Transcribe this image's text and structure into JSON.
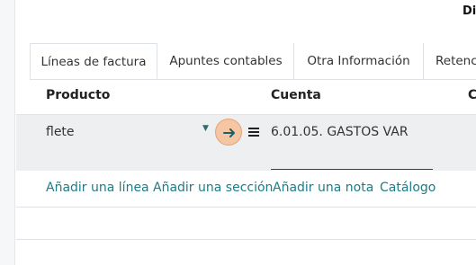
{
  "header": {
    "partial_label": "Di"
  },
  "tabs": [
    {
      "label": "Líneas de factura",
      "active": true
    },
    {
      "label": "Apuntes contables"
    },
    {
      "label": "Otra Información"
    },
    {
      "label": "Retenc"
    }
  ],
  "columns": {
    "producto": "Producto",
    "cuenta": "Cuenta",
    "third_partial": "C"
  },
  "line": {
    "producto": "flete",
    "cuenta": "6.01.05. GASTOS VAR"
  },
  "actions": {
    "add_line": "Añadir una línea",
    "add_section": "Añadir una sección",
    "add_note": "Añadir una nota",
    "catalog": "Catálogo"
  },
  "colors": {
    "link": "#1e7c86",
    "highlight": "#f4c6a4"
  }
}
